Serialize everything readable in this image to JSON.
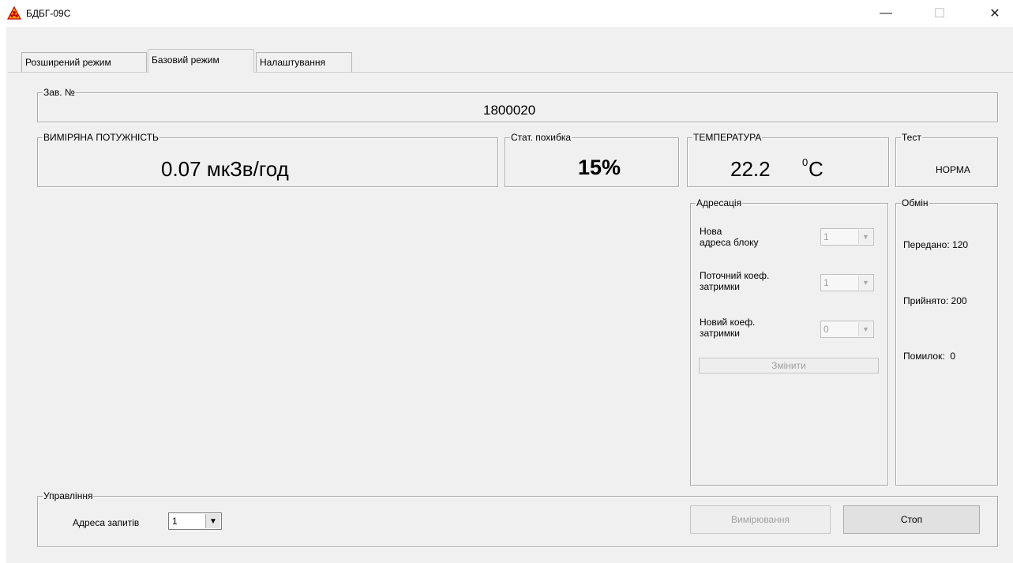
{
  "window": {
    "title": "БДБГ-09С",
    "minimize": "—",
    "maximize": "☐",
    "close": "✕"
  },
  "tabs": [
    "Розширений режим",
    "Базовий режим",
    "Налаштування"
  ],
  "serial": {
    "legend": "Зав. №",
    "value": "1800020"
  },
  "dose_rate": {
    "legend": "ВИМІРЯНА ПОТУЖНІСТЬ",
    "value": "0.07 мкЗв/год"
  },
  "stat_error": {
    "legend": "Стат. похибка",
    "value": "15%"
  },
  "temperature": {
    "legend": "ТЕМПЕРАТУРА",
    "value": "22.2",
    "unit_sup": "0",
    "unit": "C"
  },
  "test": {
    "legend": "Тест",
    "value": "НОРМА"
  },
  "addressing": {
    "legend": "Адресація",
    "new_address_label_1": "Нова",
    "new_address_label_2": "адреса блоку",
    "new_address_value": "1",
    "current_delay_label_1": "Поточний коеф.",
    "current_delay_label_2": "затримки",
    "current_delay_value": "1",
    "new_delay_label_1": "Новий коеф.",
    "new_delay_label_2": "затримки",
    "new_delay_value": "0",
    "change_button": "Змінити"
  },
  "exchange": {
    "legend": "Обмін",
    "sent": "Передано: 120",
    "received": "Прийнято: 200",
    "errors": "Помилок:  0"
  },
  "control": {
    "legend": "Управління",
    "address_label": "Адреса запитів",
    "address_value": "1",
    "measure_button": "Вимірювання",
    "stop_button": "Стоп"
  },
  "colors": {
    "window_bg": "#f0f0f0",
    "disabled_text": "#a0a0a0"
  }
}
